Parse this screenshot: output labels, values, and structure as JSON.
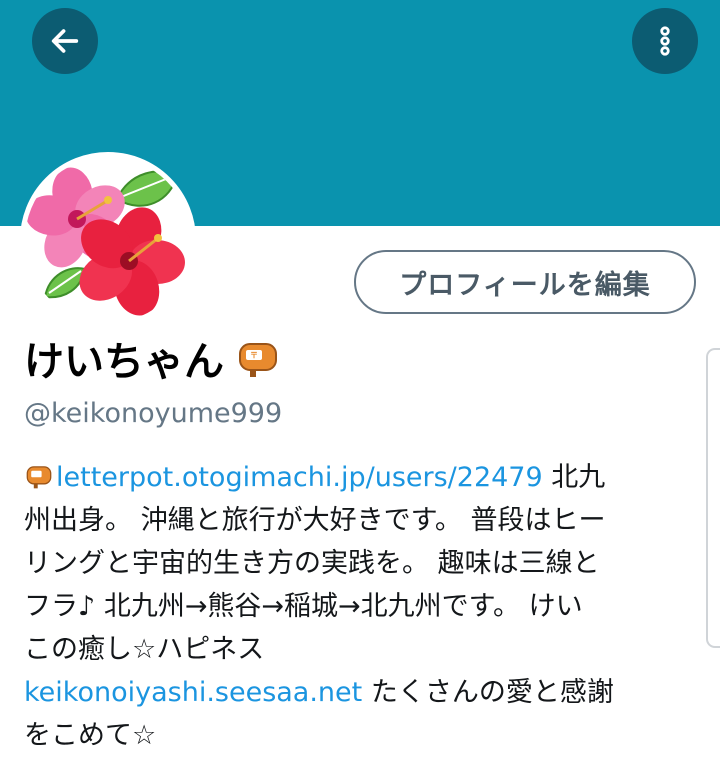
{
  "colors": {
    "banner": "#0a93ae",
    "button_dark": "#0c5c72",
    "link": "#1b95e0",
    "muted": "#657786"
  },
  "header": {
    "back_icon": "arrow-left-icon",
    "more_icon": "more-vertical-icon"
  },
  "profile": {
    "avatar": "hibiscus-avatar",
    "edit_button": "プロフィールを編集",
    "display_name": "けいちゃん",
    "name_badge_icon": "letterpot-mailbox-icon",
    "handle": "@keikonoyume999"
  },
  "bio": {
    "link1": "letterpot.otogimachi.jp/users/22479",
    "line1_text": " 北九",
    "line2": "州出身。 沖縄と旅行が大好きです。 普段はヒー",
    "line3": "リングと宇宙的生き方の実践を。 趣味は三線と",
    "line4": "フラ♪ 北九州→熊谷→稲城→北九州です。 けい",
    "line5": "この癒し☆ハピネス",
    "link2": "keikonoiyashi.seesaa.net",
    "line6_text": " たくさんの愛と感謝",
    "line7": "をこめて☆"
  }
}
